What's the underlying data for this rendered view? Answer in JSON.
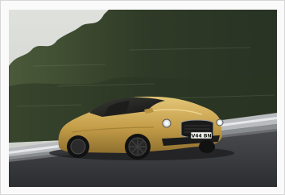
{
  "photo": {
    "subject": "car-photo",
    "license_plate": "FV44 BNL"
  },
  "colors": {
    "car_body": "#c9a44e",
    "road": "#3c3d40",
    "sky": "#d9dcd8",
    "forest": "#34402b"
  }
}
